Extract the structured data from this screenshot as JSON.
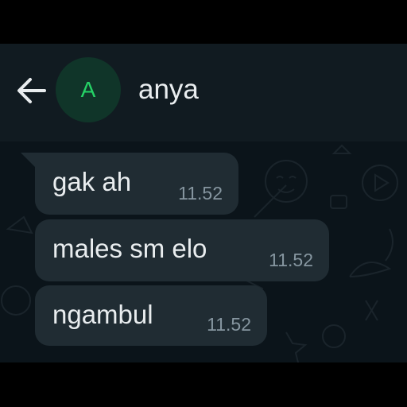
{
  "header": {
    "contact_name": "anya",
    "avatar_initial": "A",
    "back_icon": "arrow-left-icon"
  },
  "messages": [
    {
      "text": "gak ah",
      "time": "11.52"
    },
    {
      "text": "males sm elo",
      "time": "11.52"
    },
    {
      "text": "ngambul",
      "time": "11.52"
    }
  ],
  "colors": {
    "header_bg": "#111b21",
    "chat_bg": "#0b141a",
    "bubble_bg": "#202c33",
    "avatar_bg": "#103529",
    "avatar_text": "#25d366",
    "text_primary": "#e9edef",
    "text_secondary": "#8696a0"
  }
}
